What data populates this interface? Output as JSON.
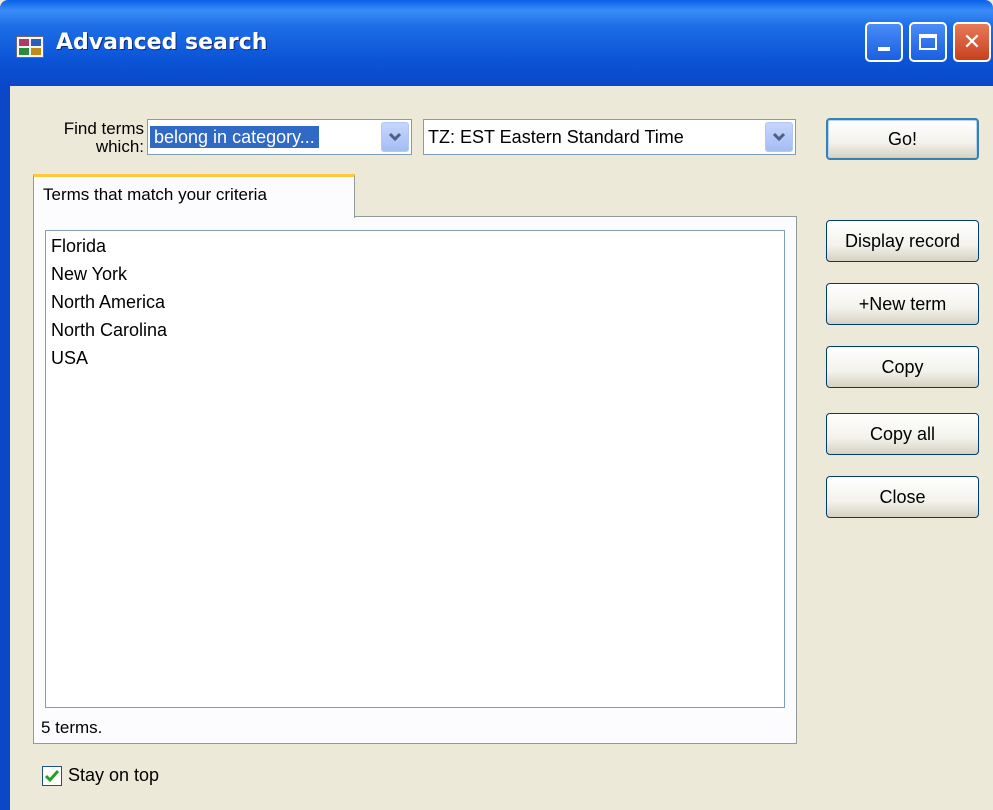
{
  "window": {
    "title": "Advanced search",
    "minimize_label": "",
    "maximize_label": "",
    "close_glyph": "✕"
  },
  "criteria": {
    "label_line1": "Find terms",
    "label_line2": "which:",
    "condition_value": "belong in category...",
    "category_value": "TZ: EST Eastern Standard Time"
  },
  "buttons": {
    "go": "Go!",
    "display_record": "Display record",
    "new_term": "+New term",
    "copy": "Copy",
    "copy_all": "Copy all",
    "close": "Close"
  },
  "results": {
    "tab_label": "Terms that match your criteria",
    "items": [
      "Florida",
      "New York",
      "North America",
      "North Carolina",
      "USA"
    ],
    "count_text": "5 terms."
  },
  "options": {
    "stay_on_top_label": "Stay on top",
    "stay_on_top_checked": true
  },
  "colors": {
    "titlebar": "#0a54d6",
    "selection": "#316ac5",
    "tab_highlight": "#ffc83c",
    "dialog_bg": "#ece9d8"
  },
  "icons": {
    "app": "grid-app-icon",
    "dropdown": "chevron-down-icon",
    "check": "checkmark-icon"
  }
}
